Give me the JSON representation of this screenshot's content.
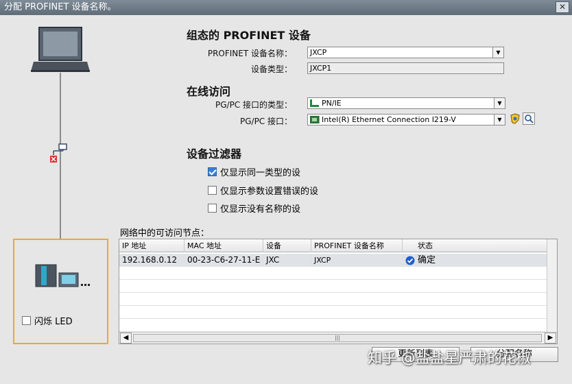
{
  "window": {
    "title": "分配 PROFINET 设备名称。",
    "close_label": "✕"
  },
  "configured": {
    "heading": "组态的 PROFINET 设备",
    "device_name_label": "PROFINET 设备名称：",
    "device_name_value": "JXCP",
    "device_type_label": "设备类型：",
    "device_type_value": "JXCP1"
  },
  "online": {
    "heading": "在线访问",
    "interface_type_label": "PG/PC 接口的类型：",
    "interface_type_value": "PN/IE",
    "interface_label": "PG/PC 接口：",
    "interface_value": "Intel(R) Ethernet Connection I219-V"
  },
  "filter": {
    "heading": "设备过滤器",
    "options": [
      {
        "label": "仅显示同一类型的设",
        "checked": true
      },
      {
        "label": "仅显示参数设置错误的设",
        "checked": false
      },
      {
        "label": "仅显示没有名称的设",
        "checked": false
      }
    ]
  },
  "nodes": {
    "caption": "网络中的可访问节点：",
    "columns": [
      "IP 地址",
      "MAC 地址",
      "设备",
      "PROFINET 设备名称",
      "状态"
    ],
    "rows": [
      {
        "ip": "192.168.0.12",
        "mac": "00-23-C6-27-11-E",
        "device": "JXC",
        "name": "JXCP",
        "status": "确定"
      }
    ]
  },
  "device_panel": {
    "flash_led_label": "闪烁 LED"
  },
  "buttons": {
    "update_list": "更新列表",
    "assign_name": "分配名称"
  },
  "watermark": "知乎 @盐盐星严肃的花椒",
  "colors": {
    "panel_border": "#f5a623",
    "status_ok": "#1f5fc9"
  }
}
